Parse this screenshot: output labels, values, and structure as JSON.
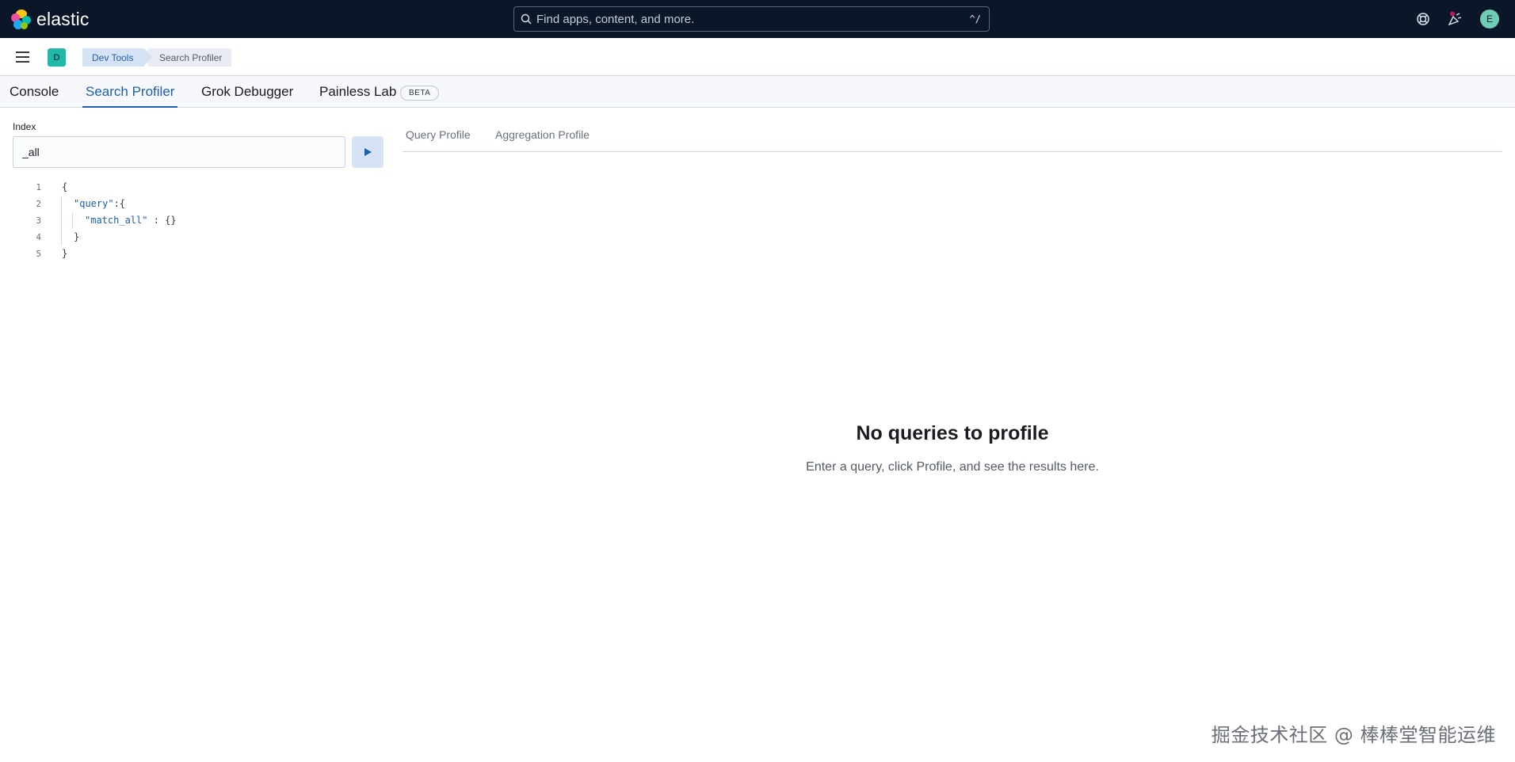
{
  "header": {
    "brand": "elastic",
    "search_placeholder": "Find apps, content, and more.",
    "search_shortcut": "^/",
    "avatar_initial": "E"
  },
  "subbar": {
    "space_initial": "D",
    "breadcrumbs": [
      "Dev Tools",
      "Search Profiler"
    ]
  },
  "tabs": {
    "items": [
      "Console",
      "Search Profiler",
      "Grok Debugger",
      "Painless Lab"
    ],
    "active": "Search Profiler",
    "beta_badge": "BETA"
  },
  "left": {
    "index_label": "Index",
    "index_value": "_all",
    "code_lines": [
      "1",
      "2",
      "3",
      "4",
      "5"
    ],
    "code": {
      "l1": "{",
      "l2_key": "\"query\"",
      "l2_rest": ":{",
      "l3_key": "\"match_all\"",
      "l3_rest": " : {}",
      "l4": "}",
      "l5": "}"
    }
  },
  "right": {
    "tabs": [
      "Query Profile",
      "Aggregation Profile"
    ],
    "empty_title": "No queries to profile",
    "empty_subtitle": "Enter a query, click Profile, and see the results here."
  },
  "watermark": "掘金技术社区 @ 棒棒堂智能运维",
  "colors": {
    "header_bg": "#0b1628",
    "accent": "#1d5fae",
    "space_badge": "#20b8a6",
    "avatar": "#6dccb1"
  }
}
